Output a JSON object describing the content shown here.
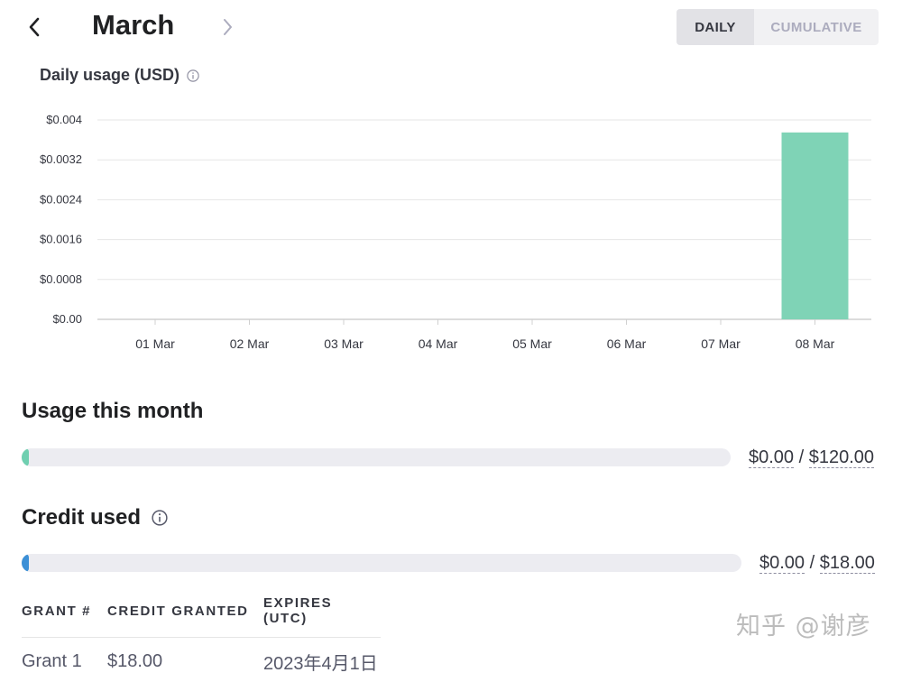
{
  "header": {
    "month": "March",
    "toggle": {
      "daily": "DAILY",
      "cumulative": "CUMULATIVE",
      "active": "daily"
    }
  },
  "chart_title": "Daily usage (USD)",
  "chart_data": {
    "type": "bar",
    "categories": [
      "01 Mar",
      "02 Mar",
      "03 Mar",
      "04 Mar",
      "05 Mar",
      "06 Mar",
      "07 Mar",
      "08 Mar"
    ],
    "values": [
      0,
      0,
      0,
      0,
      0,
      0,
      0,
      0.00375
    ],
    "ytick_labels": [
      "$0.00",
      "$0.0008",
      "$0.0016",
      "$0.0024",
      "$0.0032",
      "$0.004"
    ],
    "yticks": [
      0,
      0.0008,
      0.0016,
      0.0024,
      0.0032,
      0.004
    ],
    "ylim": [
      0,
      0.004
    ],
    "bar_color": "#7fd3b6",
    "grid": true
  },
  "usage": {
    "title": "Usage this month",
    "used": "$0.00",
    "separator": "/",
    "limit": "$120.00",
    "fill_fraction": 0.01,
    "fill_color": "#6fcfb0"
  },
  "credit": {
    "title": "Credit used",
    "used": "$0.00",
    "separator": "/",
    "total": "$18.00",
    "fill_fraction": 0.01,
    "fill_color": "#3b8fd6"
  },
  "grants": {
    "headers": [
      "GRANT #",
      "CREDIT GRANTED",
      "EXPIRES (UTC)"
    ],
    "rows": [
      {
        "grant": "Grant 1",
        "credit": "$18.00",
        "expires": "2023年4月1日"
      }
    ]
  },
  "watermark": "知乎 @谢彦"
}
